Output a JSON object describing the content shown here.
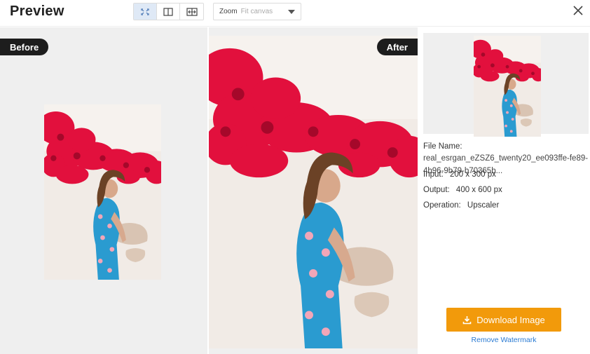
{
  "header": {
    "title": "Preview",
    "zoom_label": "Zoom",
    "zoom_value": "Fit canvas",
    "view_modes": [
      "fit-screen-icon",
      "split-view-icon",
      "slider-compare-icon"
    ],
    "active_view_mode": "fit-screen-icon"
  },
  "before": {
    "tag": "Before"
  },
  "after": {
    "tag": "After"
  },
  "info": {
    "file_name_label": "File Name:",
    "file_name_value": "real_esrgan_eZSZ6_twenty20_ee093ffe-fe89-4b96-9b79-b70365b...",
    "input_label": "Input:",
    "input_value": "200 x 300 px",
    "output_label": "Output:",
    "output_value": "400 x 600 px",
    "operation_label": "Operation:",
    "operation_value": "Upscaler"
  },
  "actions": {
    "download_label": "Download Image",
    "remove_watermark_label": "Remove Watermark"
  },
  "colors": {
    "accent": "#f29a0b",
    "link": "#2a7bd3",
    "tag_bg": "#1d1d1d",
    "canvas_bg": "#efefef"
  }
}
